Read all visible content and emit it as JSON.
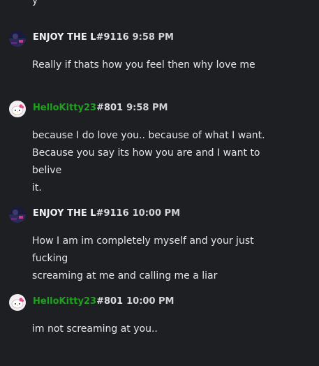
{
  "top_fragment": "y",
  "messages": [
    {
      "username": "ENJOY THE L",
      "discriminator": "#9116",
      "time": "9:58 PM",
      "lines": [
        "Really if thats how you feel then why love me"
      ]
    },
    {
      "username": "HelloKitty23",
      "discriminator": "#801",
      "time": "9:58 PM",
      "lines": [
        "because I do love you.. because of what I want.",
        "Because you say its how you are and I want to belive",
        "it."
      ]
    },
    {
      "username": "ENJOY THE L",
      "discriminator": "#9116",
      "time": "10:00 PM",
      "lines": [
        "How I am im completely myself and your just fucking",
        "screaming at me and calling me a liar"
      ]
    },
    {
      "username": "HelloKitty23",
      "discriminator": "#801",
      "time": "10:00 PM",
      "lines": [
        "im not screaming at you.."
      ]
    }
  ],
  "colors": {
    "background": "#1e1f22",
    "green_username": "#1fa11f",
    "text": "#dbdee1"
  },
  "icons": {
    "avatar_1": "dark-scene-avatar-icon",
    "avatar_2": "hello-kitty-avatar-icon"
  }
}
